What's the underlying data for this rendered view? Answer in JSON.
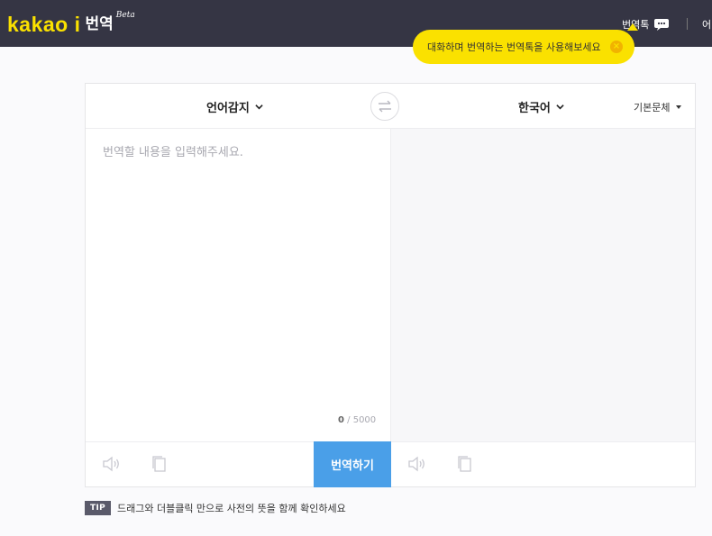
{
  "header": {
    "logo_word": "kakao i",
    "logo_service": "번역",
    "logo_beta": "Beta",
    "talk_label": "번역톡",
    "more_label": "어"
  },
  "tooltip": {
    "text": "대화하며 번역하는 번역톡을 사용해보세요",
    "close": "×"
  },
  "translator": {
    "source_lang": "언어감지",
    "target_lang": "한국어",
    "style_label": "기본문체",
    "placeholder": "번역할 내용을 입력해주세요.",
    "counter_current": "0",
    "counter_max": "/ 5000",
    "translate_label": "번역하기"
  },
  "tip": {
    "badge": "TIP",
    "text": "드래그와 더블클릭 만으로 사전의 뜻을 함께 확인하세요"
  },
  "colors": {
    "header_bg": "#353544",
    "brand_yellow": "#fae100",
    "button_blue": "#4a9fe8"
  },
  "icons": [
    "chat-bubble-icon",
    "chevron-down-icon",
    "swap-icon",
    "speaker-icon",
    "copy-icon",
    "close-icon"
  ]
}
